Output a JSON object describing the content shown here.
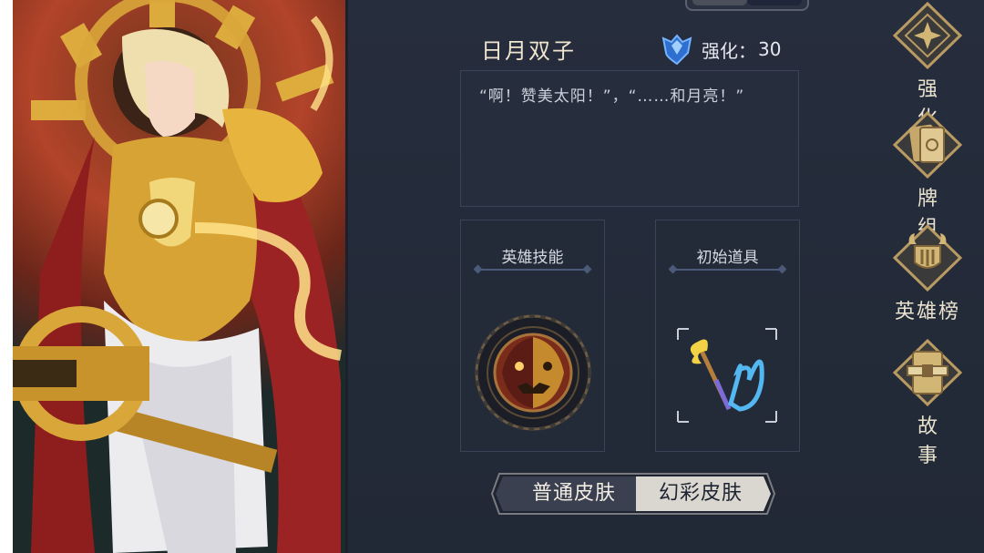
{
  "hero": {
    "name": "日月双子",
    "enhance_label": "强化：",
    "enhance_value": "30",
    "quote": "“啊！赞美太阳！”，“……和月亮！”"
  },
  "cards": {
    "skill_title": "英雄技能",
    "item_title": "初始道具"
  },
  "skins": {
    "normal": "普通皮肤",
    "colorful": "幻彩皮肤"
  },
  "side_menu": [
    {
      "label": "强化",
      "icon": "enhance-icon"
    },
    {
      "label": "牌组",
      "icon": "deck-icon"
    },
    {
      "label": "英雄榜",
      "icon": "hero-ranking-icon"
    },
    {
      "label": "故事",
      "icon": "story-icon"
    }
  ],
  "colors": {
    "background": "#252c3b",
    "gold": "#c8a45a",
    "panel_border": "#3b4356",
    "toggle_active": "#3a4050",
    "toggle_inactive": "#d9d7d0"
  }
}
